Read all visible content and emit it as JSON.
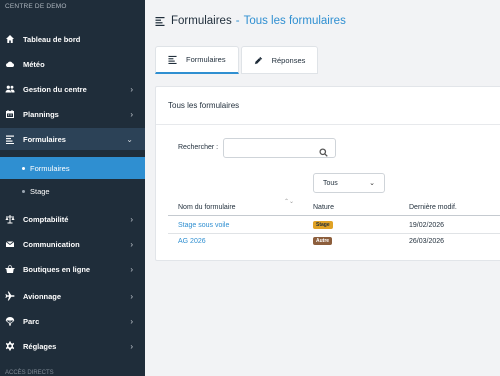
{
  "sidebar": {
    "section_label": "CENTRE DE DEMO",
    "items": [
      {
        "label": "Tableau de bord",
        "icon": "home-icon",
        "chevron": ""
      },
      {
        "label": "Météo",
        "icon": "cloud-icon",
        "chevron": ""
      },
      {
        "label": "Gestion du centre",
        "icon": "users-icon",
        "chevron": "›"
      },
      {
        "label": "Plannings",
        "icon": "calendar-icon",
        "chevron": "›"
      },
      {
        "label": "Formulaires",
        "icon": "list-icon",
        "chevron": "⌄"
      },
      {
        "label": "Comptabilité",
        "icon": "balance-icon",
        "chevron": "›"
      },
      {
        "label": "Communication",
        "icon": "envelope-icon",
        "chevron": "›"
      },
      {
        "label": "Boutiques en ligne",
        "icon": "basket-icon",
        "chevron": "›"
      },
      {
        "label": "Avionnage",
        "icon": "plane-icon",
        "chevron": "›"
      },
      {
        "label": "Parc",
        "icon": "parachute-icon",
        "chevron": "›"
      },
      {
        "label": "Réglages",
        "icon": "gear-icon",
        "chevron": "›"
      }
    ],
    "sub_items": [
      {
        "label": "Formulaires"
      },
      {
        "label": "Stage"
      }
    ],
    "footer_label": "ACCÈS DIRECTS"
  },
  "header": {
    "title": "Formulaires",
    "separator": "-",
    "breadcrumb": "Tous les formulaires"
  },
  "tabs": [
    {
      "label": "Formulaires",
      "icon": "list-icon"
    },
    {
      "label": "Réponses",
      "icon": "pencil-icon"
    }
  ],
  "card": {
    "title": "Tous les formulaires",
    "search_label": "Rechercher :",
    "search_value": "",
    "filter_value": "Tous",
    "columns": [
      "Nom du formulaire",
      "Nature",
      "Dernière modif."
    ],
    "rows": [
      {
        "name": "Stage sous voile",
        "nature": "Stage",
        "modified": "19/02/2026"
      },
      {
        "name": "AG 2026",
        "nature": "Autre",
        "modified": "26/03/2026"
      }
    ]
  },
  "colors": {
    "sidebar_bg": "#1f2d3a",
    "accent": "#2f8fd1",
    "badge_stage": "#e0a225",
    "badge_autre": "#8c5e3c"
  }
}
